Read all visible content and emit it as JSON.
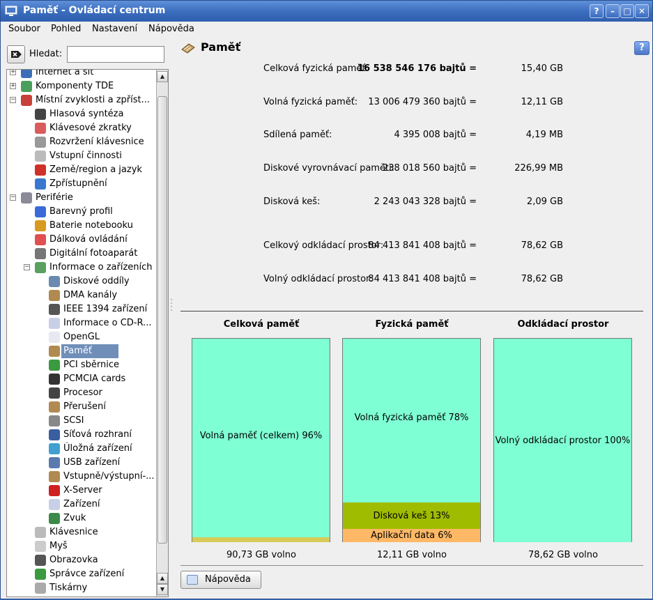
{
  "window": {
    "title": "Paměť - Ovládací centrum",
    "buttons": [
      "?",
      "–",
      "□",
      "✕"
    ]
  },
  "menu": [
    "Soubor",
    "Pohled",
    "Nastavení",
    "Nápověda"
  ],
  "search": {
    "label": "Hledat:",
    "value": ""
  },
  "tree": [
    {
      "label": "Internet a síť",
      "level": 0,
      "expander": "+",
      "icon": "#3d6fb8"
    },
    {
      "label": "Komponenty TDE",
      "level": 0,
      "expander": "+",
      "icon": "#4aa05a"
    },
    {
      "label": "Místní zvyklosti a zpříst...",
      "level": 0,
      "expander": "−",
      "icon": "#c8403a"
    },
    {
      "label": "Hlasová syntéza",
      "level": 1,
      "icon": "#444"
    },
    {
      "label": "Klávesové zkratky",
      "level": 1,
      "icon": "#d85c5c"
    },
    {
      "label": "Rozvržení klávesnice",
      "level": 1,
      "icon": "#999"
    },
    {
      "label": "Vstupní činnosti",
      "level": 1,
      "icon": "#bbb"
    },
    {
      "label": "Země/region a jazyk",
      "level": 1,
      "icon": "#d0302a"
    },
    {
      "label": "Zpřístupnění",
      "level": 1,
      "icon": "#3a78d0"
    },
    {
      "label": "Periférie",
      "level": 0,
      "expander": "−",
      "icon": "#8a8a9a"
    },
    {
      "label": "Barevný profil",
      "level": 1,
      "icon": "#3a6ad8"
    },
    {
      "label": "Baterie notebooku",
      "level": 1,
      "icon": "#d89a20"
    },
    {
      "label": "Dálková ovládání",
      "level": 1,
      "icon": "#e05050"
    },
    {
      "label": "Digitální fotoaparát",
      "level": 1,
      "icon": "#777"
    },
    {
      "label": "Informace o zařízeních",
      "level": 1,
      "expander": "−",
      "icon": "#5aa060"
    },
    {
      "label": "Diskové oddíly",
      "level": 2,
      "icon": "#6a8ab0"
    },
    {
      "label": "DMA kanály",
      "level": 2,
      "icon": "#b08a50"
    },
    {
      "label": "IEEE 1394 zařízení",
      "level": 2,
      "icon": "#555"
    },
    {
      "label": "Informace o CD-R...",
      "level": 2,
      "icon": "#c8d0e8"
    },
    {
      "label": "OpenGL",
      "level": 2,
      "icon": "#e8e8f0"
    },
    {
      "label": "Paměť",
      "level": 2,
      "icon": "#b08a50",
      "selected": true
    },
    {
      "label": "PCI sběrnice",
      "level": 2,
      "icon": "#3a9a40"
    },
    {
      "label": "PCMCIA cards",
      "level": 2,
      "icon": "#333"
    },
    {
      "label": "Procesor",
      "level": 2,
      "icon": "#444"
    },
    {
      "label": "Přerušení",
      "level": 2,
      "icon": "#b08a50"
    },
    {
      "label": "SCSI",
      "level": 2,
      "icon": "#888"
    },
    {
      "label": "Síťová rozhraní",
      "level": 2,
      "icon": "#3a5fa0"
    },
    {
      "label": "Úložná zařízení",
      "level": 2,
      "icon": "#40a0d0"
    },
    {
      "label": "USB zařízení",
      "level": 2,
      "icon": "#5a7ab0"
    },
    {
      "label": "Vstupně/výstupní-...",
      "level": 2,
      "icon": "#b08a50"
    },
    {
      "label": "X-Server",
      "level": 2,
      "icon": "#d02020"
    },
    {
      "label": "Zařízení",
      "level": 2,
      "icon": "#c8d0e8"
    },
    {
      "label": "Zvuk",
      "level": 2,
      "icon": "#3a8a4a"
    },
    {
      "label": "Klávesnice",
      "level": 1,
      "icon": "#bbb"
    },
    {
      "label": "Myš",
      "level": 1,
      "icon": "#ccc"
    },
    {
      "label": "Obrazovka",
      "level": 1,
      "icon": "#555"
    },
    {
      "label": "Správce zařízení",
      "level": 1,
      "icon": "#3a9a40"
    },
    {
      "label": "Tiskárny",
      "level": 1,
      "icon": "#aaa"
    }
  ],
  "header": {
    "title": "Paměť",
    "help": "?"
  },
  "memory": [
    {
      "label": "Celková fyzická paměť:",
      "bytes": "16 538 546 176 bajtů =",
      "value": "15,40 GB",
      "bold": true
    },
    {
      "label": "Volná fyzická paměť:",
      "bytes": "13 006 479 360 bajtů =",
      "value": "12,11 GB"
    },
    {
      "label": "Sdílená paměť:",
      "bytes": "4 395 008 bajtů =",
      "value": "4,19 MB"
    },
    {
      "label": "Diskové vyrovnávací paměti:",
      "bytes": "238 018 560 bajtů =",
      "value": "226,99 MB"
    },
    {
      "label": "Disková keš:",
      "bytes": "2 243 043 328 bajtů =",
      "value": "2,09 GB"
    },
    {
      "label": "Celkový odkládací prostor:",
      "bytes": "84 413 841 408 bajtů =",
      "value": "78,62 GB"
    },
    {
      "label": "Volný odkládací prostor:",
      "bytes": "84 413 841 408 bajtů =",
      "value": "78,62 GB"
    }
  ],
  "charts": [
    {
      "title": "Celková paměť",
      "footer": "90,73 GB volno",
      "segments": [
        {
          "label": "Volná paměť (celkem) 96%",
          "fraction": 0.975,
          "color": "#7fffd4"
        },
        {
          "label": "",
          "fraction": 0.025,
          "color": "#d8cc58"
        }
      ]
    },
    {
      "title": "Fyzická paměť",
      "footer": "12,11 GB volno",
      "segments": [
        {
          "label": "Volná fyzická paměť 78%",
          "fraction": 0.805,
          "color": "#7fffd4"
        },
        {
          "label": "Disková keš 13%",
          "fraction": 0.13,
          "color": "#a0bc00"
        },
        {
          "label": "Aplikační data 6%",
          "fraction": 0.065,
          "color": "#ffb866"
        }
      ]
    },
    {
      "title": "Odkládací prostor",
      "footer": "78,62 GB volno",
      "segments": [
        {
          "label": "Volný odkládací prostor 100%",
          "fraction": 1.0,
          "color": "#7fffd4"
        }
      ]
    }
  ],
  "help_button": "Nápověda"
}
